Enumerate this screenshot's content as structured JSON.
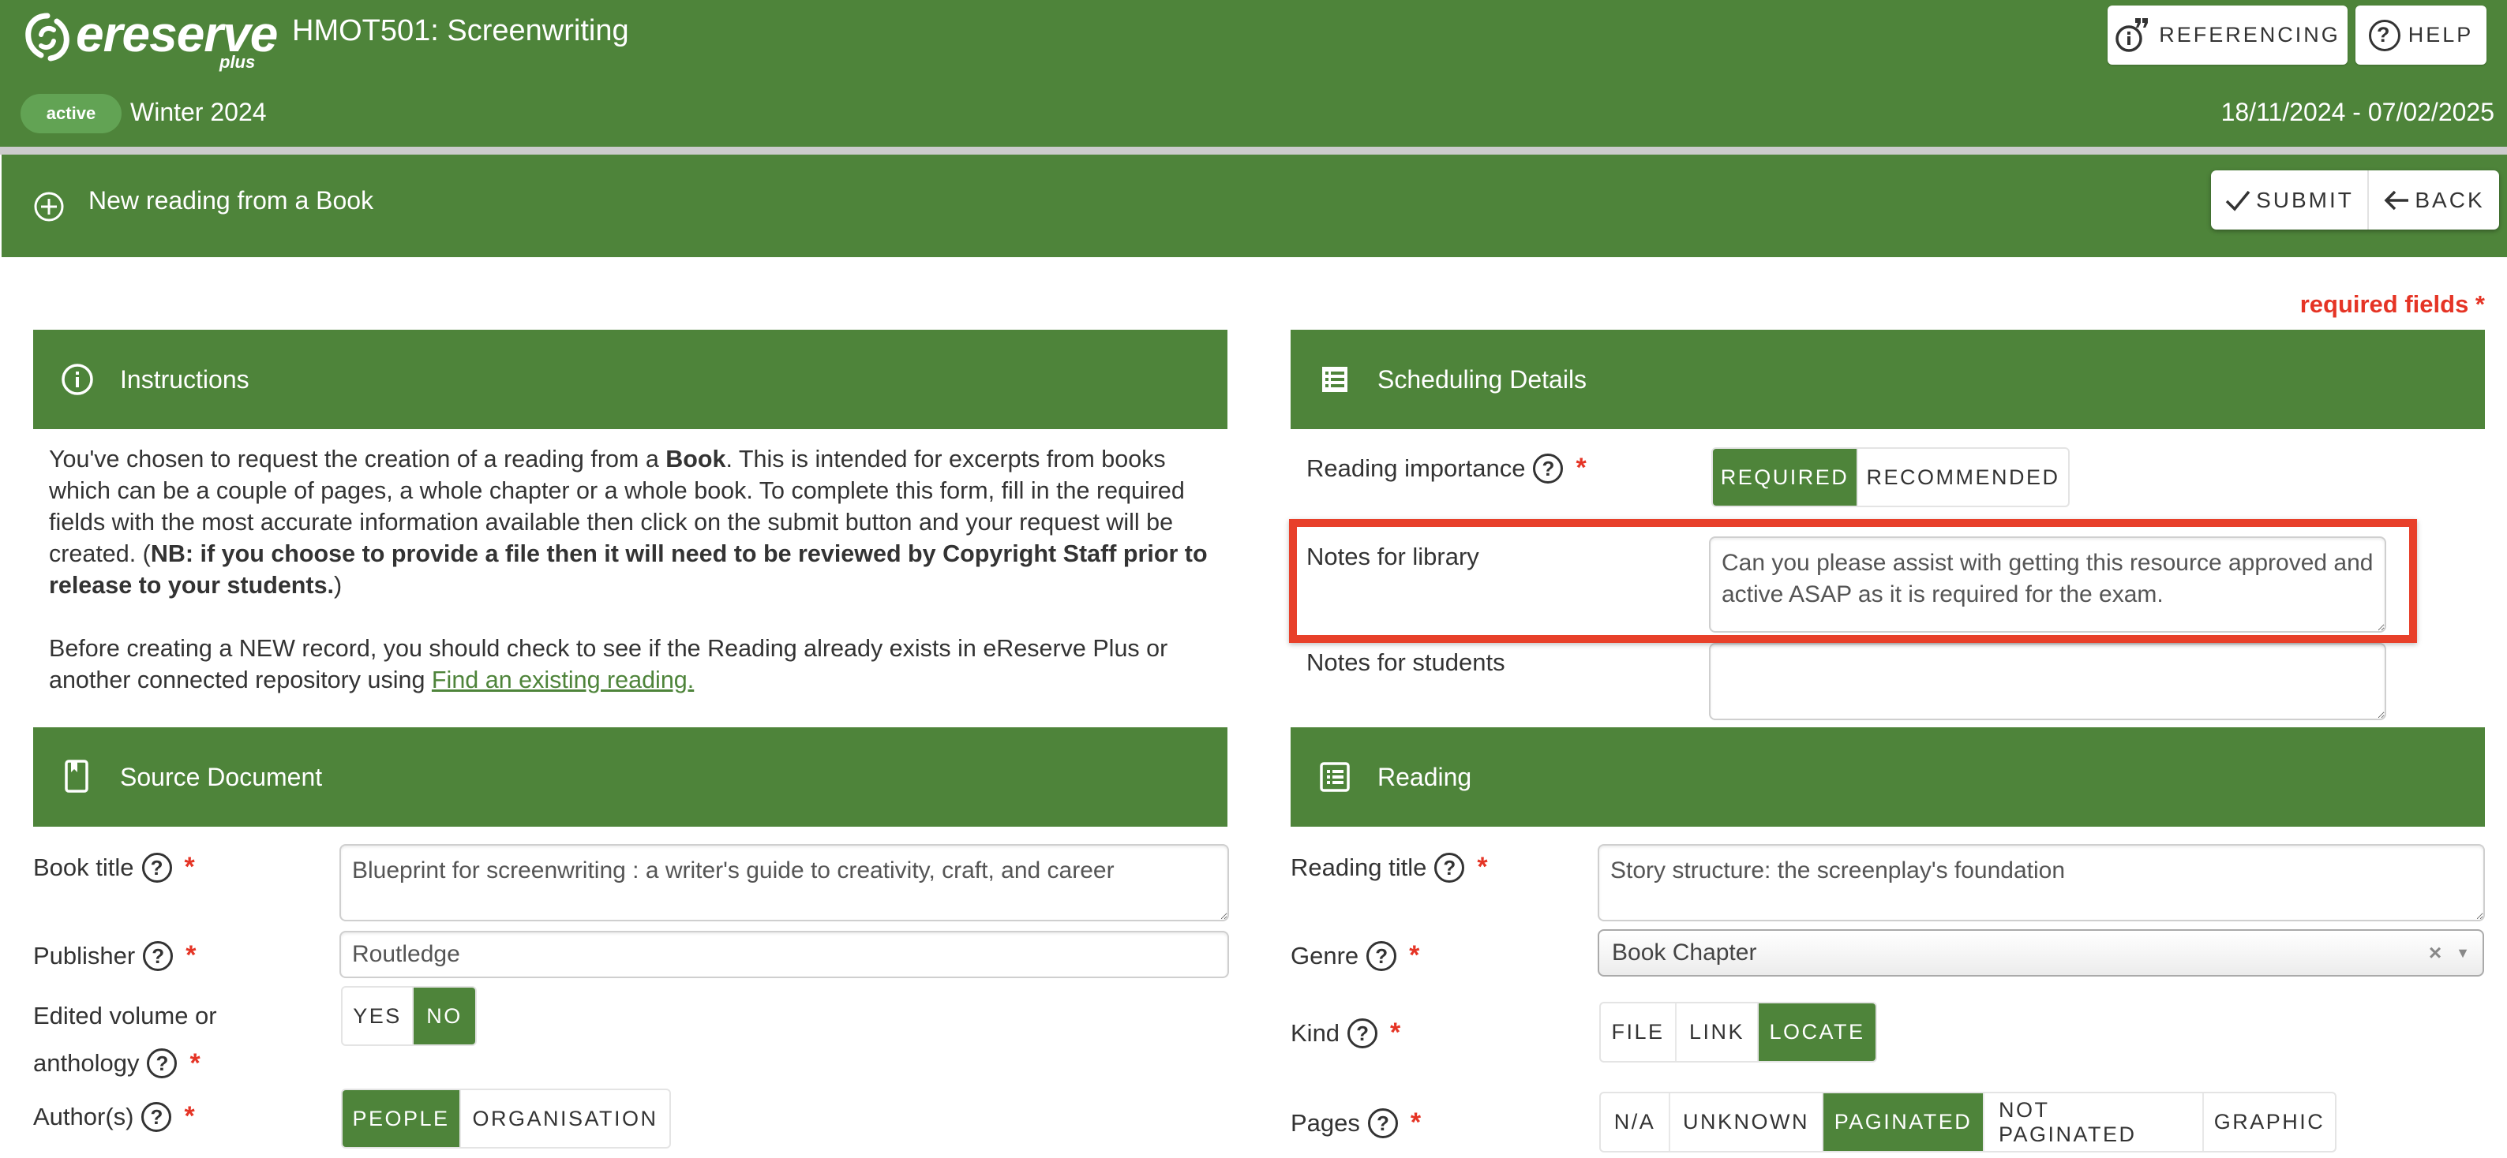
{
  "header": {
    "logo_word": "ereserve",
    "logo_sub": "plus",
    "course_title": "HMOT501: Screenwriting",
    "status_badge": "active",
    "term": "Winter 2024",
    "date_range": "18/11/2024 - 07/02/2025",
    "buttons": {
      "referencing": "REFERENCING",
      "help": "HELP"
    }
  },
  "subheader": {
    "title": "New reading from a Book",
    "submit_label": "SUBMIT",
    "back_label": "BACK"
  },
  "required_note": "required fields *",
  "colors": {
    "brand_green": "#4e843a",
    "badge_green": "#62a354",
    "required_red": "#e53425",
    "highlight_red": "#e8402a"
  },
  "instructions": {
    "title": "Instructions",
    "p1_a": "You've chosen to request the creation of a reading from a ",
    "p1_bold1": "Book",
    "p1_b": ". This is intended for excerpts from books which can be a couple of pages, a whole chapter or a whole book. To complete this form, fill in the required fields with the most accurate information available then click on the submit button and your request will be created. (",
    "p1_bold2": "NB: if you choose to provide a file then it will need to be reviewed by Copyright Staff prior to release to your students.",
    "p1_c": ")",
    "p2_a": "Before creating a NEW record, you should check to see if the Reading already exists in eReserve Plus or another connected repository using ",
    "p2_link": "Find an existing reading."
  },
  "scheduling": {
    "title": "Scheduling Details",
    "importance_label": "Reading importance",
    "importance_options": [
      {
        "label": "REQUIRED",
        "selected": true
      },
      {
        "label": "RECOMMENDED",
        "selected": false
      }
    ],
    "notes_library_label": "Notes for library",
    "notes_library_value": "Can you please assist with getting this resource approved and active ASAP as it is required for the exam.",
    "notes_students_label": "Notes for students",
    "notes_students_value": ""
  },
  "source_document": {
    "title": "Source Document",
    "book_title_label": "Book title",
    "book_title_value": "Blueprint for screenwriting : a writer's guide to creativity, craft, and career",
    "publisher_label": "Publisher",
    "publisher_value": "Routledge",
    "edited_label_line1": "Edited volume or",
    "edited_label_line2": "anthology",
    "edited_options": [
      {
        "label": "YES",
        "selected": false
      },
      {
        "label": "NO",
        "selected": true
      }
    ],
    "authors_label": "Author(s)",
    "authors_options": [
      {
        "label": "PEOPLE",
        "selected": true
      },
      {
        "label": "ORGANISATION",
        "selected": false
      }
    ]
  },
  "reading": {
    "title": "Reading",
    "reading_title_label": "Reading title",
    "reading_title_value": "Story structure: the screenplay's foundation",
    "genre_label": "Genre",
    "genre_value": "Book Chapter",
    "genre_clear": "×",
    "genre_caret": "▼",
    "kind_label": "Kind",
    "kind_options": [
      {
        "label": "FILE",
        "selected": false
      },
      {
        "label": "LINK",
        "selected": false
      },
      {
        "label": "LOCATE",
        "selected": true
      }
    ],
    "pages_label": "Pages",
    "pages_options": [
      {
        "label": "N/A",
        "selected": false
      },
      {
        "label": "UNKNOWN",
        "selected": false
      },
      {
        "label": "PAGINATED",
        "selected": true
      },
      {
        "label": "NOT PAGINATED",
        "selected": false
      },
      {
        "label": "GRAPHIC",
        "selected": false
      }
    ]
  },
  "common": {
    "help_mark": "?",
    "required_mark": "*"
  }
}
